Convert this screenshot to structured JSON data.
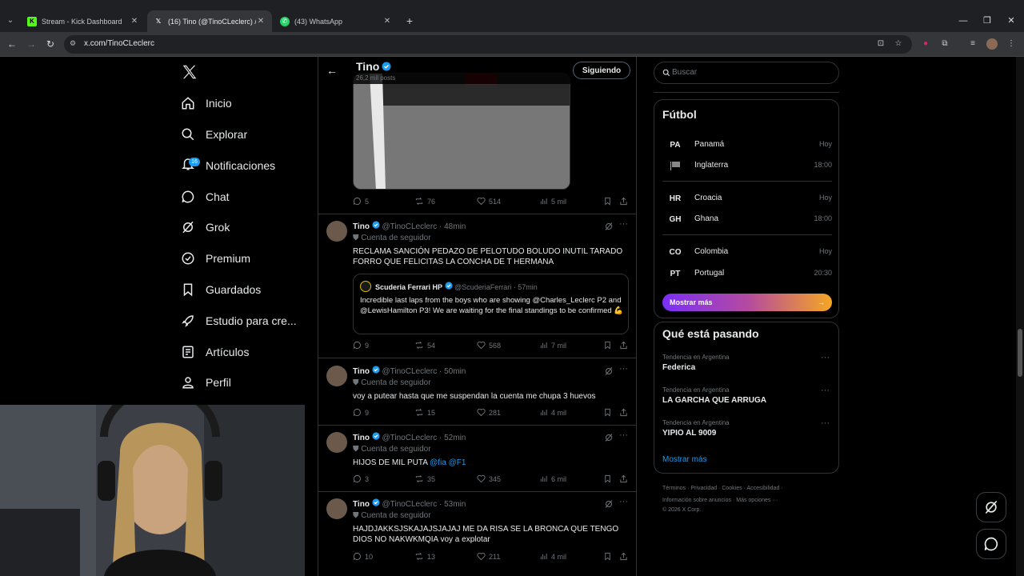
{
  "browser": {
    "tabs": [
      {
        "title": "Stream - Kick Dashboard",
        "favicon": "kick-icon"
      },
      {
        "title": "(16) Tino (@TinoCLeclerc) / X",
        "favicon": "x-icon"
      },
      {
        "title": "(43) WhatsApp",
        "favicon": "whatsapp-icon"
      }
    ],
    "url": "x.com/TinoCLeclerc"
  },
  "nav": {
    "items": [
      {
        "label": "Inicio",
        "icon": "home-icon"
      },
      {
        "label": "Explorar",
        "icon": "search-icon"
      },
      {
        "label": "Notificaciones",
        "icon": "bell-icon",
        "badge": "16"
      },
      {
        "label": "Chat",
        "icon": "chat-icon"
      },
      {
        "label": "Grok",
        "icon": "grok-icon"
      },
      {
        "label": "Premium",
        "icon": "premium-icon"
      },
      {
        "label": "Guardados",
        "icon": "bookmark-icon"
      },
      {
        "label": "Estudio para cre...",
        "icon": "rocket-icon"
      },
      {
        "label": "Artículos",
        "icon": "article-icon"
      },
      {
        "label": "Perfil",
        "icon": "person-icon"
      }
    ]
  },
  "header": {
    "name": "Tino",
    "posts": "26,2 mil posts",
    "follow_label": "Siguiendo"
  },
  "top_actions": {
    "replies": "5",
    "reposts": "76",
    "likes": "514",
    "views": "5 mil"
  },
  "tweets": [
    {
      "name": "Tino",
      "handle": "@TinoCLeclerc",
      "time": "48min",
      "sub": "Cuenta de seguidor",
      "text": "RECLAMA SANCIÓN PEDAZO DE PELOTUDO BOLUDO INUTIL TARADO FORRO QUE FELICITAS LA CONCHA DE T HERMANA",
      "quote": {
        "name": "Scuderia Ferrari HP",
        "handle": "@ScuderiaFerrari",
        "time": "57min",
        "text": "Incredible last laps from the boys who are showing @Charles_Leclerc P2 and @LewisHamilton P3!  We are waiting for the final standings to be confirmed 💪"
      },
      "replies": "9",
      "reposts": "54",
      "likes": "568",
      "views": "7 mil"
    },
    {
      "name": "Tino",
      "handle": "@TinoCLeclerc",
      "time": "50min",
      "sub": "Cuenta de seguidor",
      "text": "voy a putear hasta que me suspendan la cuenta me chupa 3 huevos",
      "replies": "9",
      "reposts": "15",
      "likes": "281",
      "views": "4 mil"
    },
    {
      "name": "Tino",
      "handle": "@TinoCLeclerc",
      "time": "52min",
      "sub": "Cuenta de seguidor",
      "text": "HIJOS DE MIL PUTA",
      "mentions": "@fia @F1",
      "replies": "3",
      "reposts": "35",
      "likes": "345",
      "views": "6 mil"
    },
    {
      "name": "Tino",
      "handle": "@TinoCLeclerc",
      "time": "53min",
      "sub": "Cuenta de seguidor",
      "text": "HAJDJAKKSJSKAJAJSJAJAJ ME DA RISA SE LA BRONCA QUE TENGO DIOS NO NAKWKMQIA voy a explotar",
      "replies": "10",
      "reposts": "13",
      "likes": "211",
      "views": "4 mil"
    }
  ],
  "search": {
    "placeholder": "Buscar"
  },
  "futbol": {
    "title": "Fútbol",
    "matches": [
      {
        "home_code": "PA",
        "home": "Panamá",
        "away": "Inglaterra",
        "time_home": "Hoy",
        "time_away": "18:00"
      },
      {
        "home_code": "HR",
        "home": "Croacia",
        "away_code": "GH",
        "away": "Ghana",
        "time_home": "Hoy",
        "time_away": "18:00"
      },
      {
        "home_code": "CO",
        "home": "Colombia",
        "away_code": "PT",
        "away": "Portugal",
        "time_home": "Hoy",
        "time_away": "20:30"
      }
    ],
    "show_more": "Mostrar más"
  },
  "trending": {
    "title": "Qué está pasando",
    "items": [
      {
        "context": "Tendencia en Argentina",
        "name": "Federica"
      },
      {
        "context": "Tendencia en Argentina",
        "name": "LA GARCHA QUE ARRUGA"
      },
      {
        "context": "Tendencia en Argentina",
        "name": "YIPIO AL 9009"
      }
    ],
    "show_more": "Mostrar más"
  },
  "footer": {
    "links": [
      "Términos",
      "Privacidad",
      "Cookies",
      "Accesibilidad",
      "Información sobre anuncios",
      "Más opciones ···"
    ],
    "copyright": "© 2026 X Corp."
  },
  "colors": {
    "accent": "#1d9bf0",
    "background": "#000000",
    "border": "#2f3336",
    "muted": "#71767b"
  }
}
